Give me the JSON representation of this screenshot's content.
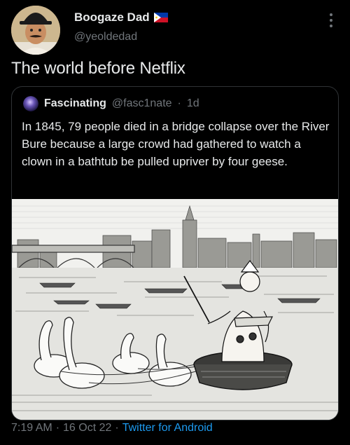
{
  "author": {
    "name": "Boogaze Dad",
    "handle": "@yeoldedad",
    "flag_icon": "philippines-flag-icon"
  },
  "tweet": {
    "text": "The world before Netflix"
  },
  "quoted_tweet": {
    "name": "Fascinating",
    "handle": "@fasc1nate",
    "separator": "·",
    "age": "1d",
    "text": "In 1845, 79 people died in a bridge collapse over the River Bure because a large crowd had gathered to watch a clown in a bathtub be pulled upriver by four geese.",
    "image_description_icon": "engraving-clown-bathtub-geese-image"
  },
  "footer": {
    "time": "7:19 AM",
    "sep1": "·",
    "date": "16 Oct 22",
    "sep2": "·",
    "source": "Twitter for Android"
  },
  "colors": {
    "background": "#000000",
    "text_primary": "#e7e9ea",
    "text_secondary": "#71767b",
    "link": "#1d9bf0",
    "border": "#2f3336"
  }
}
